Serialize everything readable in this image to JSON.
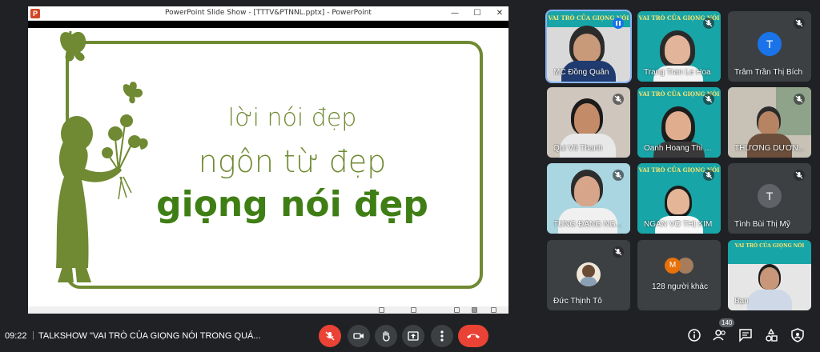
{
  "presentation": {
    "app_icon": "P",
    "window_title": "PowerPoint Slide Show - [TTTV&PTNNL.pptx] - PowerPoint",
    "slide_lines": [
      "lời nói đẹp",
      "ngôn từ đẹp",
      "giọng nói đẹp"
    ],
    "accent_color": "#6f8a32"
  },
  "participants": [
    {
      "name": "MC Đồng Quân",
      "mic": "speaking"
    },
    {
      "name": "Trang Tran Le Hoa",
      "mic": "muted"
    },
    {
      "name": "Trâm Trần Thị Bích",
      "mic": "muted",
      "initial": "T"
    },
    {
      "name": "Qui Võ Thanh",
      "mic": "muted"
    },
    {
      "name": "Oanh Hoang Thi ...",
      "mic": "muted"
    },
    {
      "name": "THƯƠNG DƯƠN...",
      "mic": "muted"
    },
    {
      "name": "TÙNG ĐẶNG NG...",
      "mic": "muted"
    },
    {
      "name": "NGÂN VÕ THỊ KIM",
      "mic": "muted"
    },
    {
      "name": "Tình Bùi Thị Mỹ",
      "mic": "muted",
      "initial": "T"
    },
    {
      "name": "Đức Thịnh Tô",
      "mic": "muted"
    },
    {
      "name": "128 người khác",
      "initial": "M"
    },
    {
      "name": "Bạn"
    }
  ],
  "tile_slide_title": "VAI TRÒ CỦA GIỌNG NÓI",
  "bottom_bar": {
    "time": "09:22",
    "divider": "|",
    "meeting_title": "TALKSHOW \"VAI TRÒ CỦA GIỌNG NÓI TRONG QUÁ...",
    "participant_count": "140",
    "icons": [
      "mic-off-icon",
      "camera-icon",
      "raise-hand-icon",
      "present-icon",
      "more-icon",
      "end-call-icon",
      "info-icon",
      "people-icon",
      "chat-icon",
      "activities-icon",
      "host-controls-icon"
    ]
  }
}
